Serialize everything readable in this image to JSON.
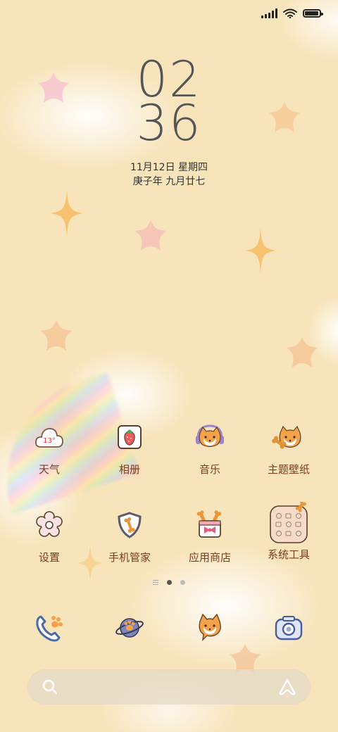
{
  "status": {
    "icons": [
      "signal-icon",
      "wifi-icon",
      "battery-icon"
    ],
    "battery_level": 0.95
  },
  "clock": {
    "hour": "02",
    "minute": "36"
  },
  "date": {
    "line1": "11月12日 星期四",
    "line2": "庚子年 九月廿七"
  },
  "apps_row1": [
    {
      "label": "天气",
      "icon": "cloud-icon",
      "temp": "13°"
    },
    {
      "label": "相册",
      "icon": "strawberry-album-icon"
    },
    {
      "label": "音乐",
      "icon": "shiba-headphones-icon"
    },
    {
      "label": "主题壁纸",
      "icon": "shiba-bone-icon"
    }
  ],
  "apps_row2": [
    {
      "label": "设置",
      "icon": "flower-gear-icon"
    },
    {
      "label": "手机管家",
      "icon": "shield-bone-icon"
    },
    {
      "label": "应用商店",
      "icon": "gift-box-icon"
    },
    {
      "label": "系统工具",
      "icon": "folder-icon"
    }
  ],
  "dock": [
    {
      "icon": "phone-paw-icon"
    },
    {
      "icon": "planet-paw-icon"
    },
    {
      "icon": "shiba-chat-icon"
    },
    {
      "icon": "camera-icon"
    }
  ],
  "page_indicator": {
    "pages": 2,
    "current": 1
  },
  "colors": {
    "background": "#f7e4bb",
    "label": "#7a3e1a",
    "accent": "#f6a23c"
  }
}
